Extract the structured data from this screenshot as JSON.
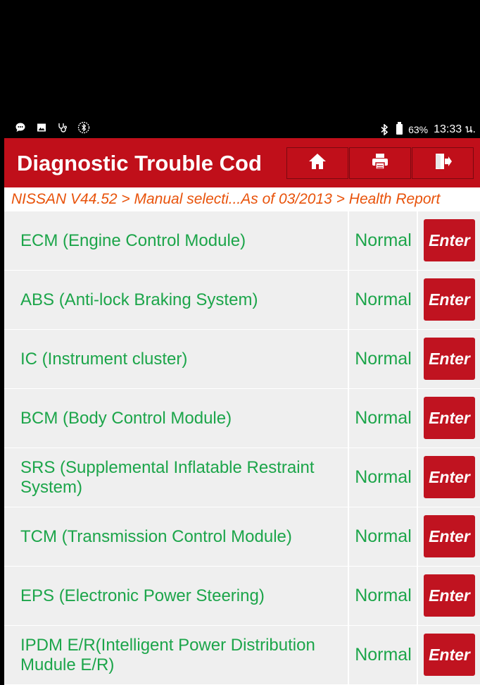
{
  "status_bar": {
    "left_icons": [
      "chat-icon",
      "image-icon",
      "stethoscope-icon",
      "bluetooth-circle-icon"
    ],
    "bluetooth_icon": "bluetooth-icon",
    "battery_percent": "63%",
    "time": "13:33 น."
  },
  "header": {
    "title": "Diagnostic Trouble Cod",
    "buttons": [
      {
        "name": "home-button",
        "icon": "home-icon"
      },
      {
        "name": "print-button",
        "icon": "printer-icon"
      },
      {
        "name": "exit-button",
        "icon": "exit-icon"
      }
    ]
  },
  "breadcrumb": "NISSAN V44.52 > Manual selecti...As of 03/2013 > Health Report",
  "colors": {
    "accent_red": "#c00f1a",
    "enter_red": "#c01320",
    "text_green": "#1ca54a",
    "breadcrumb_orange": "#e8520a"
  },
  "enter_label": "Enter",
  "rows": [
    {
      "name": "ECM (Engine Control Module)",
      "status": "Normal"
    },
    {
      "name": "ABS (Anti-lock Braking System)",
      "status": "Normal"
    },
    {
      "name": "IC (Instrument cluster)",
      "status": "Normal"
    },
    {
      "name": "BCM (Body Control Module)",
      "status": "Normal"
    },
    {
      "name": "SRS (Supplemental Inflatable Restraint System)",
      "status": "Normal"
    },
    {
      "name": "TCM (Transmission Control Module)",
      "status": "Normal"
    },
    {
      "name": "EPS (Electronic Power Steering)",
      "status": "Normal"
    },
    {
      "name": "IPDM E/R(Intelligent Power Distribution Mudule E/R)",
      "status": "Normal"
    }
  ]
}
